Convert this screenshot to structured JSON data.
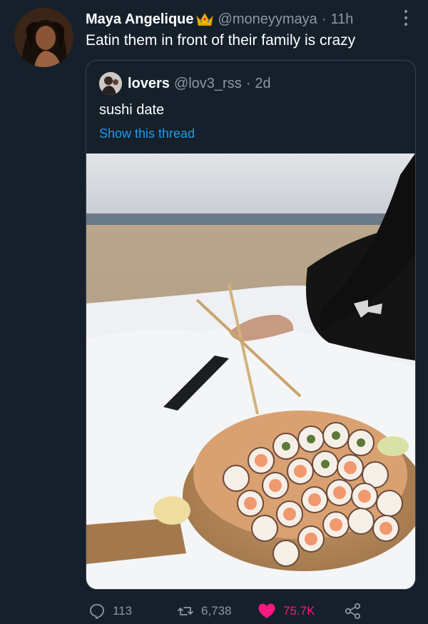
{
  "tweet": {
    "display_name": "Maya Angelique",
    "name_emoji": "crown-emoji",
    "handle": "@moneyymaya",
    "separator": "·",
    "time": "11h",
    "text": "Eatin them in front of their family is crazy",
    "avatar": "avatar-photo",
    "more_icon": "more-horizontal-icon"
  },
  "quoted_tweet": {
    "display_name": "lovers",
    "handle": "@lov3_rss",
    "separator": "·",
    "time": "2d",
    "text": "sushi date",
    "thread_link": "Show this thread",
    "media": "photo-sushi-platter-on-beach-blanket"
  },
  "actions": {
    "reply_count": "113",
    "retweet_count": "6,738",
    "like_count": "75.7K",
    "reply_icon": "reply-icon",
    "retweet_icon": "retweet-icon",
    "like_icon": "heart-icon",
    "share_icon": "share-icon"
  },
  "colors": {
    "background": "#15202b",
    "secondary_text": "#8b98a5",
    "link": "#1d9bf0",
    "like": "#f91880",
    "border": "#38444d"
  }
}
